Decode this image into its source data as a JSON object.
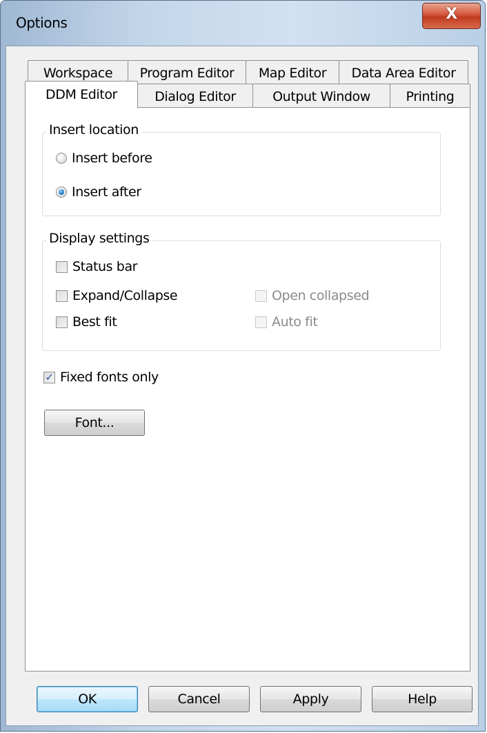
{
  "window": {
    "title": "Options",
    "close_glyph": "X"
  },
  "tabs": {
    "row_top": [
      "Workspace",
      "Program Editor",
      "Map Editor",
      "Data Area Editor"
    ],
    "row_bottom": [
      "DDM Editor",
      "Dialog Editor",
      "Output Window",
      "Printing"
    ],
    "active": "DDM Editor"
  },
  "insert_location": {
    "label": "Insert location",
    "options": [
      {
        "label": "Insert before",
        "checked": false
      },
      {
        "label": "Insert after",
        "checked": true
      }
    ]
  },
  "display_settings": {
    "label": "Display settings",
    "status_bar": {
      "label": "Status bar",
      "checked": false
    },
    "expand_collapse": {
      "label": "Expand/Collapse",
      "checked": false
    },
    "open_collapsed": {
      "label": "Open collapsed",
      "checked": false,
      "enabled": false
    },
    "best_fit": {
      "label": "Best fit",
      "checked": false
    },
    "auto_fit": {
      "label": "Auto fit",
      "checked": false,
      "enabled": false
    }
  },
  "fixed_fonts": {
    "label": "Fixed fonts only",
    "checked": true
  },
  "font_button": "Font...",
  "buttons": {
    "ok": "OK",
    "cancel": "Cancel",
    "apply": "Apply",
    "help": "Help"
  },
  "check_glyph": "✓"
}
